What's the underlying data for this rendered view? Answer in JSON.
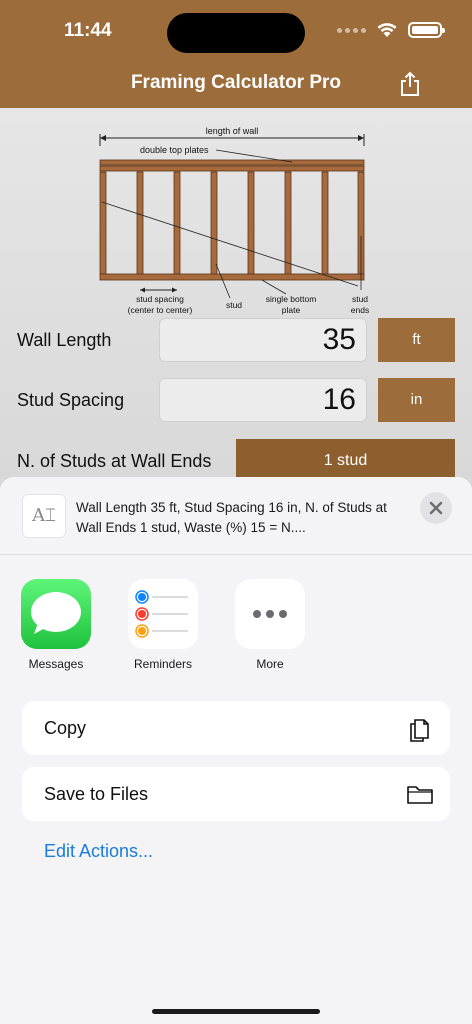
{
  "status": {
    "time": "11:44"
  },
  "header": {
    "title": "Framing Calculator Pro"
  },
  "diagram": {
    "length_of_wall": "length of wall",
    "double_top_plates": "double top plates",
    "stud_spacing_line1": "stud spacing",
    "stud_spacing_line2": "(center to center)",
    "stud": "stud",
    "single_bottom_line1": "single bottom",
    "single_bottom_line2": "plate",
    "stud_ends_line1": "stud",
    "stud_ends_line2": "ends"
  },
  "form": {
    "wall_length": {
      "label": "Wall Length",
      "value": "35",
      "unit": "ft"
    },
    "stud_spacing": {
      "label": "Stud Spacing",
      "value": "16",
      "unit": "in"
    },
    "studs_at_ends": {
      "label": "N. of Studs at Wall Ends",
      "value": "1 stud"
    }
  },
  "share_sheet": {
    "preview_text": "Wall Length 35 ft, Stud Spacing 16 in, N. of Studs at Wall Ends 1 stud, Waste (%) 15 = N....",
    "apps": [
      {
        "label": "Messages",
        "icon": "messages-icon"
      },
      {
        "label": "Reminders",
        "icon": "reminders-icon"
      },
      {
        "label": "More",
        "icon": "more-icon"
      }
    ],
    "actions": [
      {
        "label": "Copy",
        "icon": "copy-icon"
      },
      {
        "label": "Save to Files",
        "icon": "folder-icon"
      }
    ],
    "edit_actions": "Edit Actions..."
  },
  "colors": {
    "brand": "#9c6c3a",
    "link": "#1a7cd8",
    "messages_green": "#34c759"
  }
}
